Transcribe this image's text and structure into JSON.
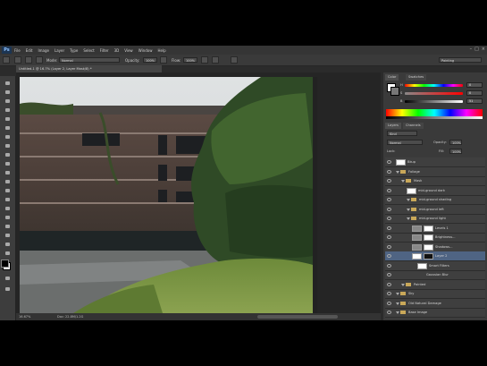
{
  "app": {
    "logo": "Ps"
  },
  "menu": [
    "File",
    "Edit",
    "Image",
    "Layer",
    "Type",
    "Select",
    "Filter",
    "3D",
    "View",
    "Window",
    "Help"
  ],
  "window_controls": {
    "minimize": "–",
    "maximize": "□",
    "close": "×"
  },
  "options": {
    "mode_label": "Mode:",
    "mode_value": "Normal",
    "opacity_label": "Opacity:",
    "opacity_value": "100%",
    "flow_label": "Flow:",
    "flow_value": "100%",
    "workspace": "Painting"
  },
  "document": {
    "tab_title": "Untitled-1 @ 16.7% (Layer 2, Layer Mask/8) *",
    "zoom": "16.67%",
    "doc_size": "Doc: 22.8M/1.2G"
  },
  "panels": {
    "color_tab": "Color",
    "swatches_tab": "Swatches",
    "color": {
      "labels": [
        "H",
        "S",
        "B"
      ],
      "values": [
        "0",
        "0",
        "51"
      ]
    },
    "layers_tab": "Layers",
    "channels_tab": "Channels",
    "kind_label": "Kind",
    "blend_mode": "Normal",
    "opacity_label": "Opacity:",
    "opacity_value": "100%",
    "lock_label": "Lock:",
    "fill_label": "Fill:",
    "fill_value": "100%"
  },
  "layers": [
    {
      "name": "Bkup",
      "type": "thumb"
    },
    {
      "name": "Foliage",
      "type": "folder"
    },
    {
      "name": "Mask",
      "type": "folder"
    },
    {
      "name": "mid-ground dark",
      "type": "thumb"
    },
    {
      "name": "mid-ground shading",
      "type": "folder"
    },
    {
      "name": "mid-ground left",
      "type": "folder"
    },
    {
      "name": "mid-ground light",
      "type": "folder"
    },
    {
      "name": "Levels 1",
      "type": "adj"
    },
    {
      "name": "Brightness...",
      "type": "adj"
    },
    {
      "name": "Shadows...",
      "type": "adj"
    },
    {
      "name": "Layer 2",
      "type": "mask"
    },
    {
      "name": "Smart Filters",
      "type": "thumb"
    },
    {
      "name": "Gaussian Blur",
      "type": "fx"
    },
    {
      "name": "Painted",
      "type": "folder"
    },
    {
      "name": "Sky",
      "type": "folder"
    },
    {
      "name": "Old Natural Damage",
      "type": "folder"
    },
    {
      "name": "Base Image",
      "type": "folder"
    }
  ],
  "colors": {
    "accent": "#4f6483",
    "panel_bg": "#3a3a3a",
    "menu_bg": "#353535"
  }
}
